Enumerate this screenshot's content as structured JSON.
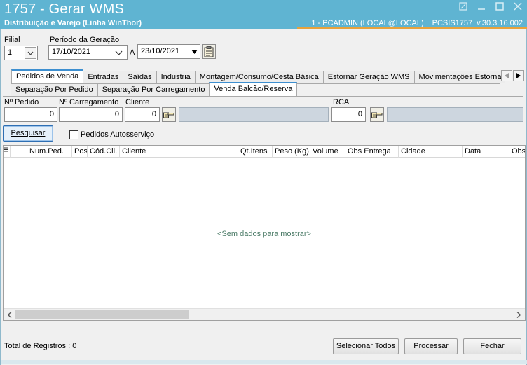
{
  "window": {
    "title": "1757 - Gerar WMS",
    "subtitle": "Distribuição e Varejo (Linha WinThor)",
    "user": "1 - PCADMIN (LOCAL@LOCAL)",
    "system": "PCSIS1757",
    "version": "v.30.3.16.002"
  },
  "filters": {
    "filial_label": "Filial",
    "filial_value": "1",
    "periodo_label": "Período da Geração",
    "date_from": "17/10/2021",
    "date_sep": "A",
    "date_to": "23/10/2021"
  },
  "main_tabs": [
    {
      "label": "Pedidos de Venda",
      "active": true
    },
    {
      "label": "Entradas"
    },
    {
      "label": "Saídas"
    },
    {
      "label": "Industria"
    },
    {
      "label": "Montagem/Consumo/Cesta Básica"
    },
    {
      "label": "Estornar Geração WMS"
    },
    {
      "label": "Movimentações Estornad"
    }
  ],
  "sub_tabs": [
    {
      "label": "Separação Por Pedido"
    },
    {
      "label": "Separação Por Carregamento"
    },
    {
      "label": "Venda Balcão/Reserva",
      "active": true
    }
  ],
  "search": {
    "pedido_label": "Nº Pedido",
    "pedido_value": "0",
    "carregamento_label": "Nº Carregamento",
    "carregamento_value": "0",
    "cliente_label": "Cliente",
    "cliente_value": "0",
    "rca_label": "RCA",
    "rca_value": "0",
    "pesquisar_label": "Pesquisar",
    "autoservico_label": "Pedidos Autosserviço"
  },
  "grid": {
    "columns": [
      "Num.Ped.",
      "Pos",
      "Cód.Cli.",
      "Cliente",
      "Qt.Itens",
      "Peso (Kg)",
      "Volume",
      "Obs Entrega",
      "Cidade",
      "Data",
      "Obs"
    ],
    "empty_text": "<Sem dados para mostrar>"
  },
  "footer": {
    "total_label": "Total de Registros : 0",
    "select_all": "Selecionar Todos",
    "process": "Processar",
    "close": "Fechar"
  }
}
